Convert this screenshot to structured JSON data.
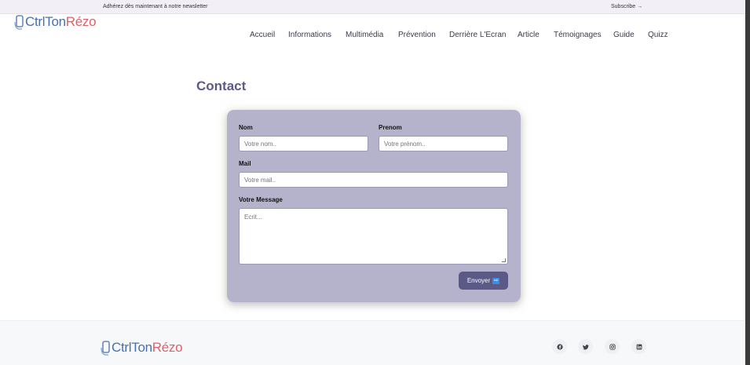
{
  "topbar": {
    "newsletter_text": "Adhérez dès maintenant à notre newsletter",
    "subscribe_label": "Subscribe",
    "subscribe_arrow": "→"
  },
  "brand": {
    "part1": "CtrlTon",
    "part2": "Rézo"
  },
  "nav": {
    "items": [
      "Accueil",
      "Informations",
      "Multimédia",
      "Prévention",
      "Derrière L'Ecran",
      "Article",
      "Témoignages",
      "Guide",
      "Quizz"
    ]
  },
  "page": {
    "title": "Contact"
  },
  "form": {
    "nom_label": "Nom",
    "nom_placeholder": "Votre nom..",
    "prenom_label": "Prenom",
    "prenom_placeholder": "Votre prénom..",
    "mail_label": "Mail",
    "mail_placeholder": "Votre mail..",
    "message_label": "Votre Message",
    "message_placeholder": "Ecrit...",
    "submit_label": "Envoyer",
    "submit_icon": "⇨"
  },
  "colors": {
    "accent": "#5b5986",
    "card_bg": "#b5b3cb",
    "title": "#5c5a8a",
    "brand_blue": "#4a6fb0",
    "brand_red": "#e0606a"
  },
  "footer": {
    "social": [
      "facebook-icon",
      "twitter-icon",
      "instagram-icon",
      "linkedin-icon"
    ]
  }
}
